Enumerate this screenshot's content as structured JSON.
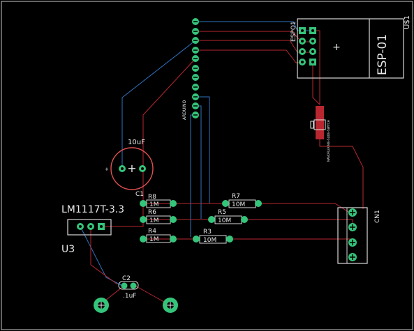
{
  "colors": {
    "background": "#000000",
    "silkscreen": "#e0e0e0",
    "pad": "#34c47a",
    "top_copper": "#b8272f",
    "bottom_copper": "#2f74c0",
    "capacitor_outline": "#e05050"
  },
  "parts": {
    "esp": {
      "ref": "ESPO1",
      "name": "ESP-01",
      "ref2": "U$1"
    },
    "header": {
      "label": "ARDUINO"
    },
    "cap_big": {
      "value": "10uF"
    },
    "c1": {
      "ref": "C1"
    },
    "reg": {
      "name": "LM1117T-3.3",
      "ref": "U3"
    },
    "r8": {
      "ref": "R8",
      "value": "1M"
    },
    "r6": {
      "ref": "R6",
      "value": "1M"
    },
    "r4": {
      "ref": "R4",
      "value": "1M"
    },
    "r7": {
      "ref": "R7",
      "value": "10M"
    },
    "r5": {
      "ref": "R5",
      "value": "10M"
    },
    "r3": {
      "ref": "R3",
      "value": "10M"
    },
    "cn1": {
      "ref": "CN1"
    },
    "c2": {
      "ref": "C2",
      "value": ".1uF"
    },
    "slide": {
      "label": "NANOFLEX-NIE-SLIDE-SWITCH"
    }
  }
}
